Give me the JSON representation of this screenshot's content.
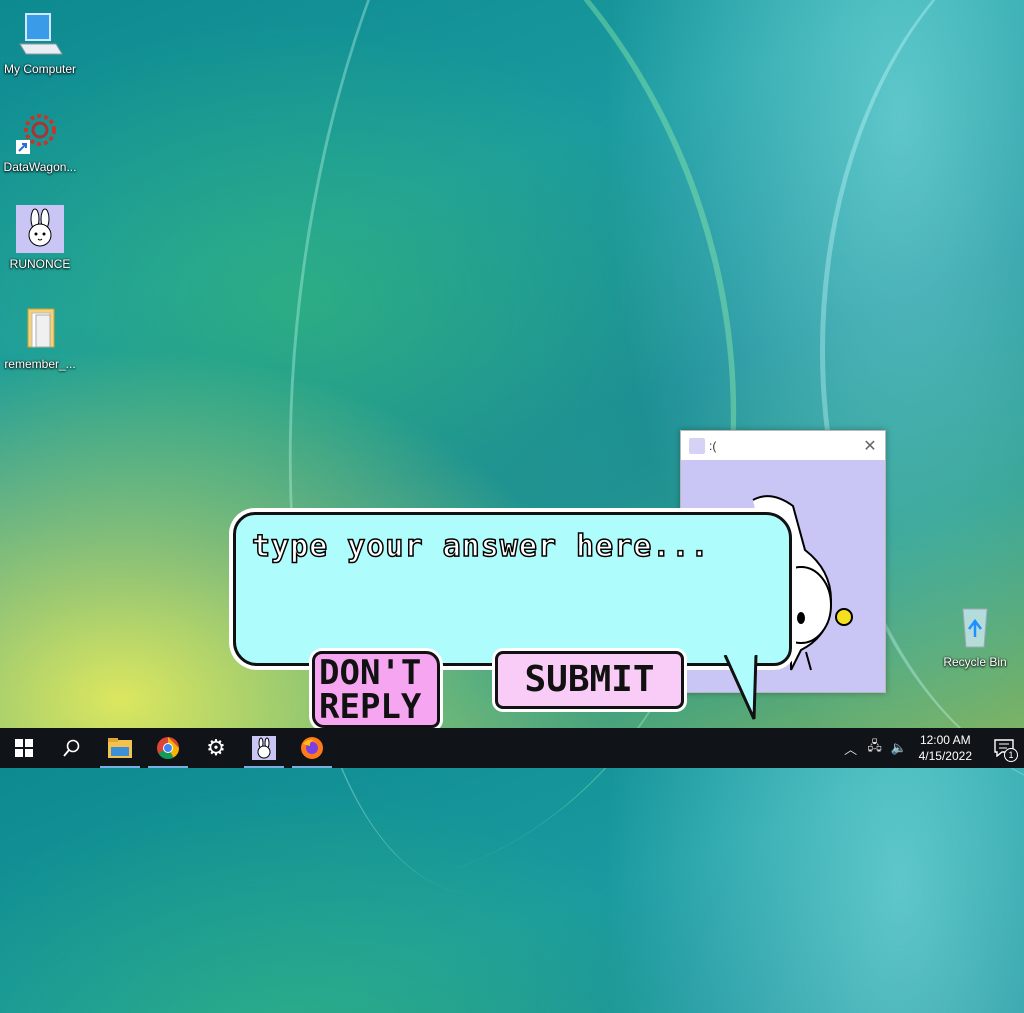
{
  "desktop": {
    "icons": [
      {
        "label": "My Computer",
        "icon": "computer-icon"
      },
      {
        "label": "DataWagon...",
        "icon": "datawagon-icon"
      },
      {
        "label": "RUNONCE",
        "icon": "bunny-icon"
      },
      {
        "label": "remember_...",
        "icon": "folder-icon"
      },
      {
        "label": "Recycle Bin",
        "icon": "recycle-bin-icon"
      }
    ]
  },
  "window": {
    "title": ":("
  },
  "dialog": {
    "prompt": "type your answer here...",
    "dont_reply_line1": "DON'T",
    "dont_reply_line2": "REPLY",
    "submit_label": "SUBMIT"
  },
  "taskbar": {
    "apps": [
      "start-icon",
      "search-icon",
      "file-explorer-icon",
      "chrome-icon",
      "settings-gear-icon",
      "bunny-app-icon",
      "firefox-icon"
    ],
    "clock_time": "12:00 AM",
    "clock_date": "4/15/2022",
    "notification_count": "1"
  }
}
